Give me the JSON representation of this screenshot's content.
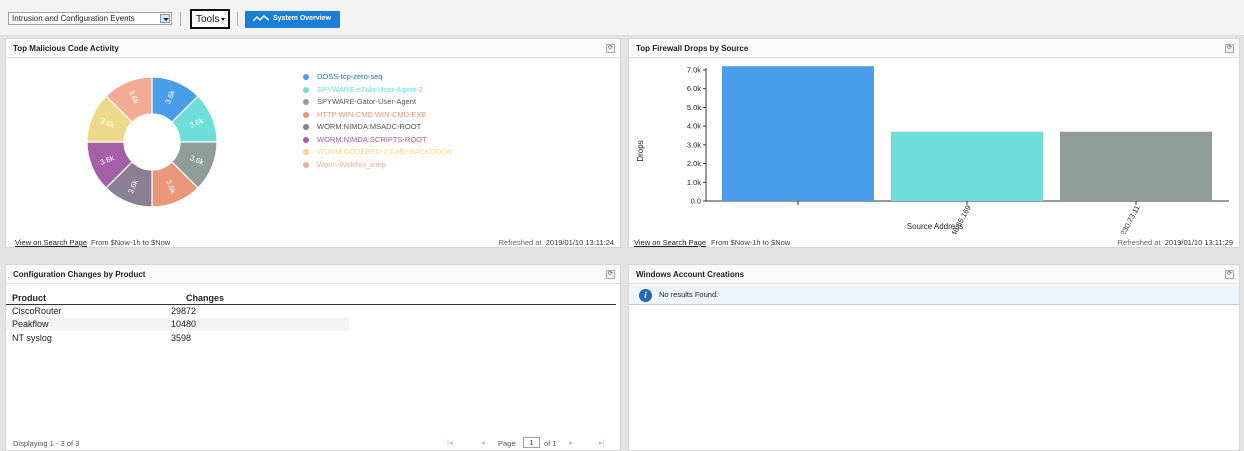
{
  "toolbar": {
    "dashboard_select": "Intrusion and Configuration Events",
    "tools_label": "Tools",
    "system_overview_label": "System Overview"
  },
  "panels": {
    "malicious": {
      "title": "Top Malicious Code Activity",
      "view_link": "View on Search Page",
      "range": "From $Now-1h to $Now",
      "refreshed_label": "Refreshed at",
      "refreshed_time": "2019/01/10 13:11:24"
    },
    "firewall": {
      "title": "Top Firewall Drops by Source",
      "view_link": "View on Search Page",
      "range": "From $Now-1h to $Now",
      "refreshed_label": "Refreshed at",
      "refreshed_time": "2019/01/10 13:11:29"
    },
    "config": {
      "title": "Configuration Changes by Product",
      "columns": [
        "Product",
        "Changes"
      ],
      "rows": [
        {
          "product": "CiscoRouter",
          "changes": "29872"
        },
        {
          "product": "Peakflow",
          "changes": "10480"
        },
        {
          "product": "NT syslog",
          "changes": "3598"
        }
      ],
      "displaying": "Displaying 1 - 3 of 3",
      "page_label": "Page",
      "page_value": "1",
      "of_label": "of 1"
    },
    "windows": {
      "title": "Windows Account Creations",
      "message": "No results Found."
    }
  },
  "chart_data": [
    {
      "type": "pie",
      "title": "Top Malicious Code Activity",
      "donut": true,
      "slice_label": "3.6k",
      "categories": [
        "DOSS-tcp-zero-seq",
        "SPYWARE-eZula-User-Agent-2",
        "SPYWARE-Gator-User-Agent",
        "HTTP:WIN-CMD:WIN-CMD-EXE",
        "WORM:NIMDA:MSADC-ROOT",
        "WORM:NIMDA:SCRIPTS-ROOT",
        "WORM:CODERED-2:CMD-BACKDOOR",
        "Worm-Welchia_icmp"
      ],
      "values": [
        3600,
        3600,
        3600,
        3600,
        3600,
        3600,
        3600,
        3600
      ],
      "colors": [
        "#4a9de8",
        "#6ddfd8",
        "#8e9d97",
        "#e9967a",
        "#8a7f93",
        "#a45fa6",
        "#ecd98a",
        "#f4ab93"
      ],
      "legend": "right"
    },
    {
      "type": "bar",
      "title": "Top Firewall Drops by Source",
      "xlabel": "Source Address",
      "ylabel": "Drops",
      "categories": [
        "",
        "199.248.65.169",
        "29.230.73.11"
      ],
      "values": [
        7200,
        3700,
        3700
      ],
      "colors": [
        "#4a9de8",
        "#6ddfd8",
        "#8e9d97"
      ],
      "ylim": [
        0,
        7000
      ],
      "yticks": [
        "0.0",
        "1.0k",
        "2.0k",
        "3.0k",
        "4.0k",
        "5.0k",
        "6.0k",
        "7.0k"
      ],
      "grid": false
    }
  ]
}
